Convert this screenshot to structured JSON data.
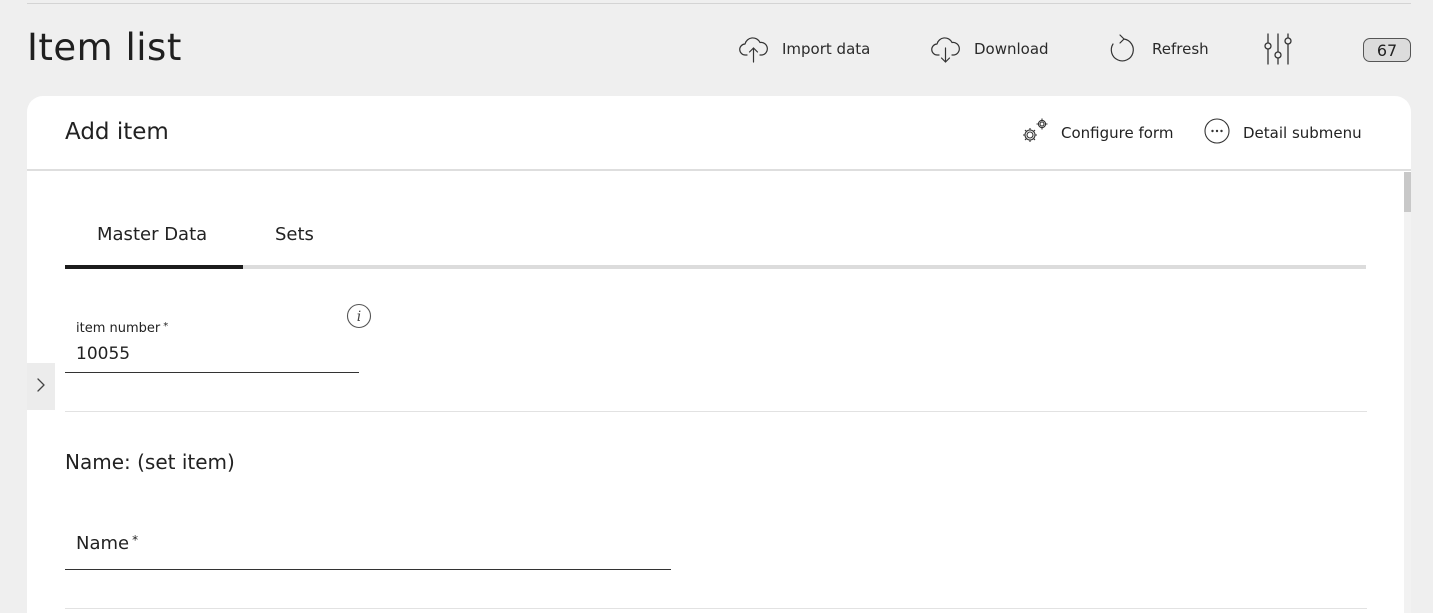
{
  "page": {
    "title": "Item list"
  },
  "toolbar": {
    "import_label": "Import data",
    "download_label": "Download",
    "refresh_label": "Refresh",
    "count": "67"
  },
  "card": {
    "title": "Add item",
    "configure_label": "Configure form",
    "detail_label": "Detail submenu"
  },
  "tabs": [
    {
      "label": "Master Data",
      "active": true
    },
    {
      "label": "Sets",
      "active": false
    }
  ],
  "fields": {
    "item_number": {
      "label": "item number",
      "required_mark": "*",
      "value": "10055"
    },
    "name": {
      "label": "Name",
      "required_mark": "*",
      "value": ""
    }
  },
  "section": {
    "title": "Name: (set item)"
  },
  "colors": {
    "accent": "#1c1c1c",
    "background": "#efefef",
    "card": "#ffffff"
  }
}
